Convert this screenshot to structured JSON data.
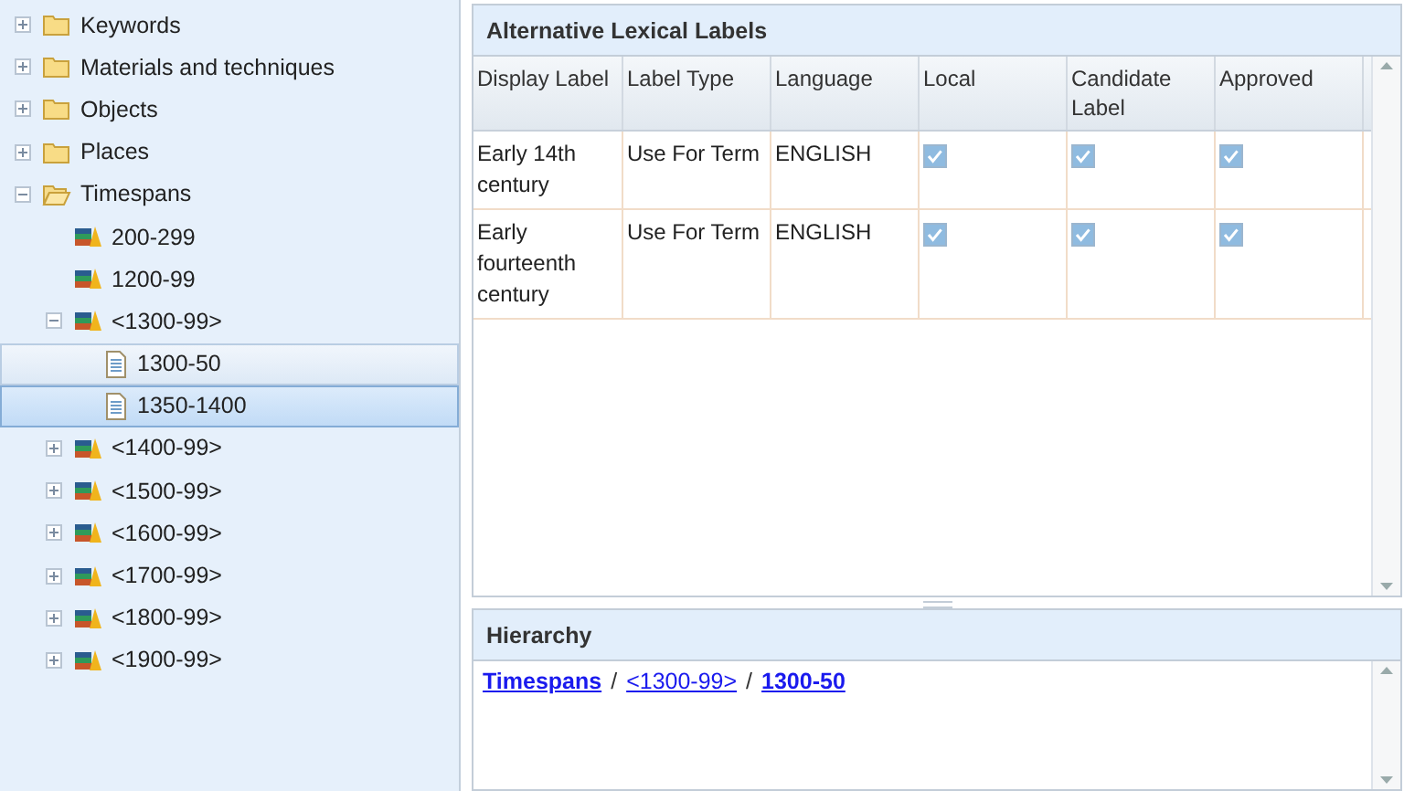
{
  "tree": [
    {
      "label": "Keywords",
      "kind": "folder",
      "expanded": false,
      "selected": false,
      "hovered": false
    },
    {
      "label": "Materials and techniques",
      "kind": "folder",
      "expanded": false,
      "selected": false,
      "hovered": false
    },
    {
      "label": "Objects",
      "kind": "folder",
      "expanded": false,
      "selected": false,
      "hovered": false
    },
    {
      "label": "Places",
      "kind": "folder",
      "expanded": false,
      "selected": false,
      "hovered": false
    },
    {
      "label": "Timespans",
      "kind": "folder",
      "expanded": true,
      "selected": false,
      "hovered": false,
      "children": [
        {
          "label": "200-299",
          "kind": "books",
          "selected": false,
          "hovered": false
        },
        {
          "label": "1200-99",
          "kind": "books",
          "selected": false,
          "hovered": false
        },
        {
          "label": "<1300-99>",
          "kind": "books",
          "expanded": true,
          "selected": false,
          "hovered": false,
          "children": [
            {
              "label": "1300-50",
              "kind": "page",
              "selected": false,
              "hovered": true
            },
            {
              "label": "1350-1400",
              "kind": "page",
              "selected": true,
              "hovered": false
            }
          ]
        },
        {
          "label": "<1400-99>",
          "kind": "books",
          "expanded": false,
          "selected": false,
          "hovered": false
        },
        {
          "label": "<1500-99>",
          "kind": "books",
          "expanded": false,
          "selected": false,
          "hovered": false
        },
        {
          "label": "<1600-99>",
          "kind": "books",
          "expanded": false,
          "selected": false,
          "hovered": false
        },
        {
          "label": "<1700-99>",
          "kind": "books",
          "expanded": false,
          "selected": false,
          "hovered": false
        },
        {
          "label": "<1800-99>",
          "kind": "books",
          "expanded": false,
          "selected": false,
          "hovered": false
        },
        {
          "label": "<1900-99>",
          "kind": "books",
          "expanded": false,
          "selected": false,
          "hovered": false
        }
      ]
    }
  ],
  "labels_panel": {
    "title": "Alternative Lexical Labels",
    "columns": [
      "Display Label",
      "Label Type",
      "Language",
      "Local",
      "Candidate Label",
      "Approved"
    ],
    "rows": [
      {
        "display_label": "Early 14th century",
        "label_type": "Use For Term",
        "language": "ENGLISH",
        "local": true,
        "candidate": true,
        "approved": true
      },
      {
        "display_label": "Early fourteenth century",
        "label_type": "Use For Term",
        "language": "ENGLISH",
        "local": true,
        "candidate": true,
        "approved": true
      }
    ]
  },
  "hierarchy_panel": {
    "title": "Hierarchy",
    "path": [
      {
        "kind": "link",
        "text": "Timespans",
        "bold": true
      },
      {
        "kind": "separator",
        "text": "/"
      },
      {
        "kind": "link",
        "text": "<1300-99>",
        "bold": false
      },
      {
        "kind": "separator",
        "text": "/"
      },
      {
        "kind": "link",
        "text": "1300-50",
        "bold": true
      }
    ]
  }
}
